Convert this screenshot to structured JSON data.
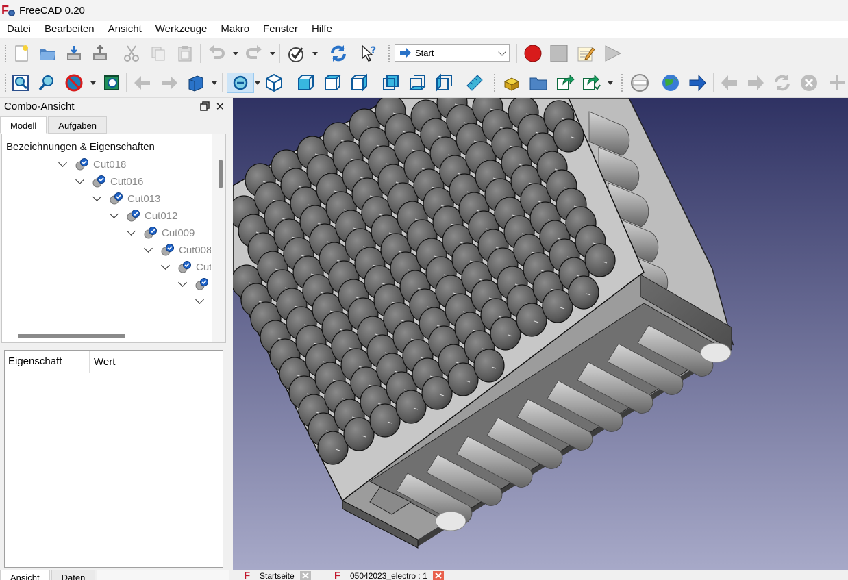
{
  "window": {
    "title": "FreeCAD 0.20"
  },
  "menu": {
    "items": [
      "Datei",
      "Bearbeiten",
      "Ansicht",
      "Werkzeuge",
      "Makro",
      "Fenster",
      "Hilfe"
    ]
  },
  "toolbar": {
    "workbench_value": "Start",
    "icons_row1": [
      "new-document-icon",
      "open-icon",
      "import-icon",
      "export-icon",
      "cut-icon",
      "copy-icon",
      "paste-icon",
      "undo-icon",
      "redo-icon",
      "refresh-icon",
      "whats-this-icon",
      "macro-record-icon",
      "macro-stop-icon",
      "macro-edit-icon",
      "macro-run-icon"
    ],
    "icons_row2": [
      "fit-all-icon",
      "fit-selection-icon",
      "draw-style-icon",
      "bounding-box-icon",
      "back-icon",
      "forward-icon",
      "std-views-icon",
      "sync-view-icon",
      "isometric-icon",
      "front-icon",
      "top-icon",
      "right-icon",
      "rear-icon",
      "bottom-icon",
      "left-icon",
      "measure-icon",
      "part-icon",
      "group-icon",
      "link-icon",
      "link-actions-icon",
      "web-home-icon",
      "web-icon",
      "web-forward-icon",
      "web-back-icon",
      "web-next-icon",
      "web-refresh-icon",
      "web-stop-icon",
      "add-icon"
    ]
  },
  "combo": {
    "title": "Combo-Ansicht",
    "tabs": [
      "Modell",
      "Aufgaben"
    ],
    "tree_heading": "Bezeichnungen & Eigenschaften",
    "tree_items": [
      "Cut018",
      "Cut016",
      "Cut013",
      "Cut012",
      "Cut009",
      "Cut008",
      "Cut",
      "",
      ""
    ],
    "property_columns": [
      "Eigenschaft",
      "Wert"
    ],
    "bottom_tabs": [
      "Ansicht",
      "Daten"
    ]
  },
  "documents": {
    "tabs": [
      "Startseite",
      "05042023_electro : 1"
    ]
  },
  "colors": {
    "view_top": "#2f3263",
    "view_bottom": "#a7a9c8",
    "accent_blue": "#2a73c8",
    "record_red": "#d81b1b"
  }
}
